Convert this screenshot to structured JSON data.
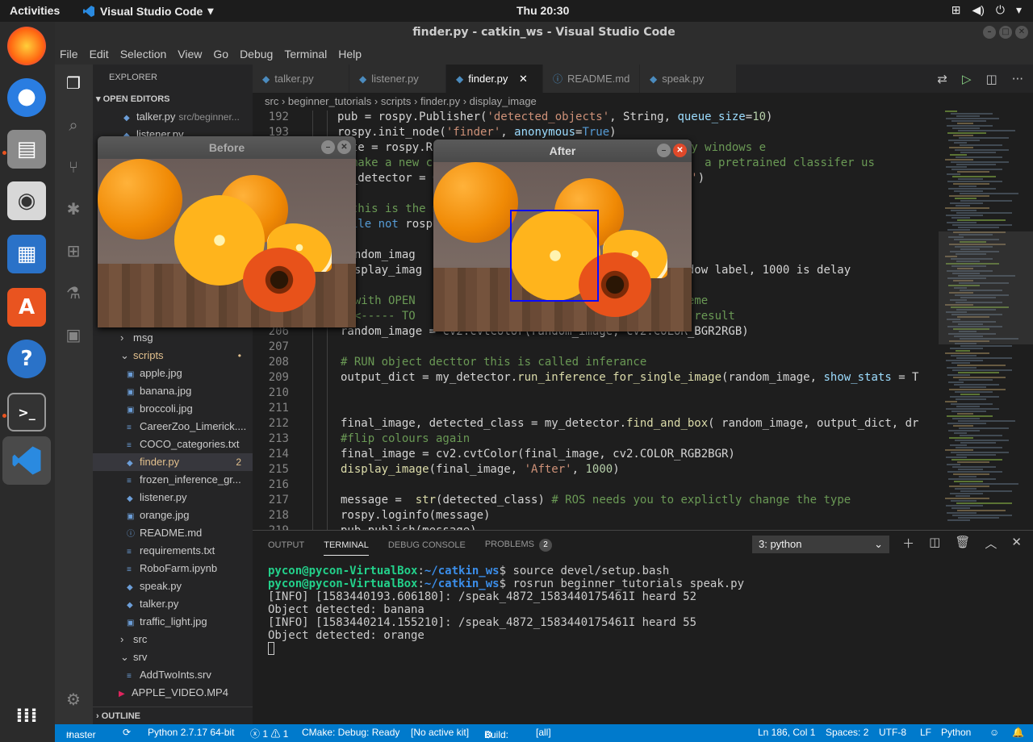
{
  "system": {
    "activities": "Activities",
    "app_name": "Visual Studio Code",
    "clock": "Thu 20:30"
  },
  "window": {
    "title": "finder.py - catkin_ws - Visual Studio Code"
  },
  "menu": [
    "File",
    "Edit",
    "Selection",
    "View",
    "Go",
    "Debug",
    "Terminal",
    "Help"
  ],
  "sidebar": {
    "header": "EXPLORER",
    "open_editors": "OPEN EDITORS",
    "open_first": "talker.py",
    "open_first_desc": "src/beginner...",
    "open_second": "listener.py",
    "outline": "OUTLINE",
    "items": [
      {
        "label": "msg",
        "kind": "folder",
        "indent": 1
      },
      {
        "label": "scripts",
        "kind": "folder-open",
        "indent": 1,
        "badge": "•"
      },
      {
        "label": "apple.jpg",
        "kind": "image",
        "indent": 2
      },
      {
        "label": "banana.jpg",
        "kind": "image",
        "indent": 2
      },
      {
        "label": "broccoli.jpg",
        "kind": "image",
        "indent": 2
      },
      {
        "label": "CareerZoo_Limerick....",
        "kind": "file",
        "indent": 2
      },
      {
        "label": "COCO_categories.txt",
        "kind": "file",
        "indent": 2
      },
      {
        "label": "finder.py",
        "kind": "py",
        "indent": 2,
        "badge": "2",
        "selected": true
      },
      {
        "label": "frozen_inference_gr...",
        "kind": "file",
        "indent": 2
      },
      {
        "label": "listener.py",
        "kind": "py",
        "indent": 2
      },
      {
        "label": "orange.jpg",
        "kind": "image",
        "indent": 2
      },
      {
        "label": "README.md",
        "kind": "info",
        "indent": 2
      },
      {
        "label": "requirements.txt",
        "kind": "file",
        "indent": 2
      },
      {
        "label": "RoboFarm.ipynb",
        "kind": "file",
        "indent": 2
      },
      {
        "label": "speak.py",
        "kind": "py",
        "indent": 2
      },
      {
        "label": "talker.py",
        "kind": "py",
        "indent": 2
      },
      {
        "label": "traffic_light.jpg",
        "kind": "image",
        "indent": 2
      },
      {
        "label": "src",
        "kind": "folder",
        "indent": 1
      },
      {
        "label": "srv",
        "kind": "folder-open",
        "indent": 1
      },
      {
        "label": "AddTwoInts.srv",
        "kind": "file",
        "indent": 2
      },
      {
        "label": "APPLE_VIDEO.MP4",
        "kind": "video",
        "indent": 0
      }
    ]
  },
  "tabs": [
    {
      "label": "talker.py",
      "active": false
    },
    {
      "label": "listener.py",
      "active": false
    },
    {
      "label": "finder.py",
      "active": true
    },
    {
      "label": "README.md",
      "active": false
    },
    {
      "label": "speak.py",
      "active": false
    }
  ],
  "breadcrumb": [
    "src",
    "beginner_tutorials",
    "scripts",
    "finder.py",
    "display_image"
  ],
  "code_lines": [
    {
      "n": "192",
      "html": "pub = rospy.Publisher(<span class='st'>'detected_objects'</span>, String, <span class='vr'>queue_size</span>=<span class='nm'>10</span>)",
      "indent": 0
    },
    {
      "n": "193",
      "html": "rospy.init_node(<span class='st'>'finder'</span>, <span class='vr'>anonymous</span>=<span class='kw'>True</span>)",
      "indent": 0
    },
    {
      "n": "",
      "html": "rate = rospy.Rate(<span class='nm'>1</span>) <span class='cm'># NOTE ! rate must allow display windows e</span>",
      "indent": 0
    },
    {
      "n": "",
      "html": "<span class='cm'># make a new c                          graph.pb' is  a pretrained classifer us</span>",
      "indent": 0
    },
    {
      "n": "",
      "html": "my_detector = O                     <span class='st'>ference_graph.pb'</span>)",
      "indent": 0
    },
    {
      "n": "",
      "html": "",
      "indent": 0
    },
    {
      "n": "",
      "html": "<span class='cm'># this is the m</span>",
      "indent": 0
    },
    {
      "n": "",
      "html": "<span class='kw'>while not</span> rospy",
      "indent": 0
    },
    {
      "n": "",
      "html": "",
      "indent": 0
    },
    {
      "n": "",
      "html": "random_imag",
      "indent": 1
    },
    {
      "n": "",
      "html": "display_imag                          <span class='st'>efore'</span> is window label, 1000 is delay",
      "indent": 1
    },
    {
      "n": "",
      "html": "",
      "indent": 1
    },
    {
      "n": "",
      "html": "<span class='cm'># with OPEN                           he colour scheme</span>",
      "indent": 1
    },
    {
      "n": "",
      "html": "<span class='cm'># &lt;----- TO                            w it effects result</span>",
      "indent": 1
    },
    {
      "n": "206",
      "html": "random_image = cv2.cvtColor(random_image, cv2.COLOR_BGR2RGB)",
      "indent": 1
    },
    {
      "n": "207",
      "html": "",
      "indent": 1
    },
    {
      "n": "208",
      "html": "<span class='cm'># RUN object decttor this is called inferance</span>",
      "indent": 1
    },
    {
      "n": "209",
      "html": "output_dict = my_detector.<span class='fn'>run_inference_for_single_image</span>(random_image, <span class='vr'>show_stats</span> = T",
      "indent": 1
    },
    {
      "n": "210",
      "html": "",
      "indent": 1
    },
    {
      "n": "211",
      "html": "",
      "indent": 1
    },
    {
      "n": "212",
      "html": "final_image, detected_class = my_detector.<span class='fn'>find_and_box</span>( random_image, output_dict, dr",
      "indent": 1
    },
    {
      "n": "213",
      "html": "<span class='cm'>#flip colours again</span>",
      "indent": 1
    },
    {
      "n": "214",
      "html": "final_image = cv2.cvtColor(final_image, cv2.COLOR_RGB2BGR)",
      "indent": 1
    },
    {
      "n": "215",
      "html": "<span class='fn'>display_image</span>(final_image, <span class='st'>'After'</span>, <span class='nm'>1000</span>)",
      "indent": 1
    },
    {
      "n": "216",
      "html": "",
      "indent": 1
    },
    {
      "n": "217",
      "html": "message =  <span class='fn'>str</span>(detected_class) <span class='cm'># ROS needs you to explictly change the type</span>",
      "indent": 1
    },
    {
      "n": "218",
      "html": "rospy.loginfo(message)",
      "indent": 1
    },
    {
      "n": "219",
      "html": "pub.publish(message)",
      "indent": 1
    }
  ],
  "panel": {
    "tabs": [
      "OUTPUT",
      "TERMINAL",
      "DEBUG CONSOLE",
      "PROBLEMS"
    ],
    "problems_count": "2",
    "terminal_select": "3: python",
    "lines": [
      {
        "type": "prompt",
        "user": "pycon@pycon-VirtualBox",
        "path": "~/catkin_ws",
        "cmd": "$ source devel/setup.bash"
      },
      {
        "type": "prompt",
        "user": "pycon@pycon-VirtualBox",
        "path": "~/catkin_ws",
        "cmd": "$ rosrun beginner_tutorials speak.py"
      },
      {
        "type": "out",
        "text": "[INFO] [1583440193.606180]: /speak_4872_1583440175461I heard 52"
      },
      {
        "type": "out",
        "text": "Object detected: banana"
      },
      {
        "type": "out",
        "text": "[INFO] [1583440214.155210]: /speak_4872_1583440175461I heard 55"
      },
      {
        "type": "out",
        "text": "Object detected: orange"
      }
    ]
  },
  "popups": {
    "before_title": "Before",
    "after_title": "After"
  },
  "status": {
    "branch": "master",
    "python": "Python 2.7.17 64-bit",
    "problems": "ⓧ 1 ⚠ 1",
    "cmake": "CMake: Debug: Ready",
    "kit": "[No active kit]",
    "build": "Build:",
    "target": "[all]",
    "position": "Ln 186, Col 1",
    "spaces": "Spaces: 2",
    "encoding": "UTF-8",
    "eol": "LF",
    "language": "Python"
  },
  "colors": {
    "accent": "#007acc",
    "ubuntu_orange": "#e95420",
    "detect_box": "#0000ff"
  }
}
